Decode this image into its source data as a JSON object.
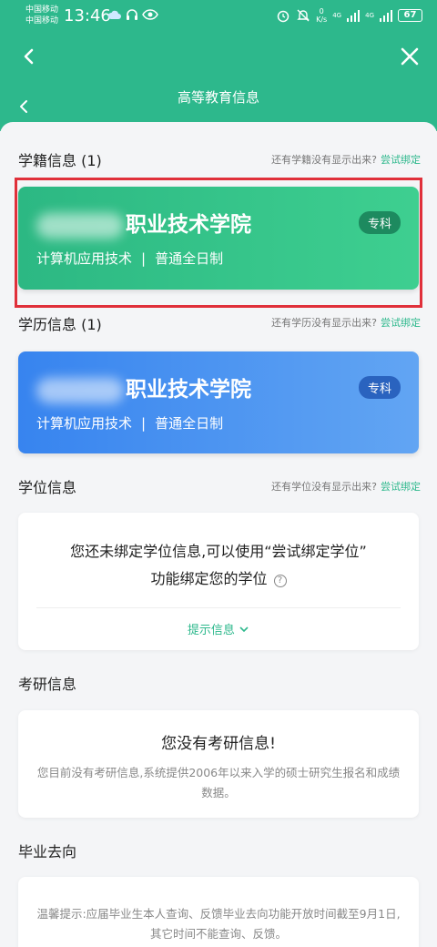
{
  "status_bar": {
    "carrier_1": "中国移动",
    "carrier_2": "中国移动",
    "time": "13:46",
    "speed_value": "0",
    "speed_unit": "K/s",
    "signal_1": "4G",
    "signal_2": "4G",
    "battery": "67"
  },
  "nav": {
    "back_icon": "chevron-left-icon",
    "close_icon": "close-icon"
  },
  "page": {
    "title": "高等教育信息"
  },
  "xueji": {
    "title": "学籍信息 (1)",
    "hint": "还有学籍没有显示出来?",
    "hint_link": "尝试绑定",
    "card": {
      "school": "职业技术学院",
      "major": "计算机应用技术",
      "separator": "|",
      "mode": "普通全日制",
      "level": "专科"
    }
  },
  "xueli": {
    "title": "学历信息 (1)",
    "hint": "还有学历没有显示出来?",
    "hint_link": "尝试绑定",
    "card": {
      "school": "职业技术学院",
      "major": "计算机应用技术",
      "separator": "|",
      "mode": "普通全日制",
      "level": "专科"
    }
  },
  "xuewei": {
    "title": "学位信息",
    "hint": "还有学位没有显示出来?",
    "hint_link": "尝试绑定",
    "message_line1": "您还未绑定学位信息,可以使用“尝试绑定学位”",
    "message_line2": "功能绑定您的学位",
    "tips": "提示信息"
  },
  "kaoyan": {
    "title": "考研信息",
    "heading": "您没有考研信息!",
    "text": "您目前没有考研信息,系统提供2006年以来入学的硕士研究生报名和成绩数据。"
  },
  "biye": {
    "title": "毕业去向",
    "text": "温馨提示:应届毕业生本人查询、反馈毕业去向功能开放时间截至9月1日,其它时间不能查询、反馈。"
  }
}
